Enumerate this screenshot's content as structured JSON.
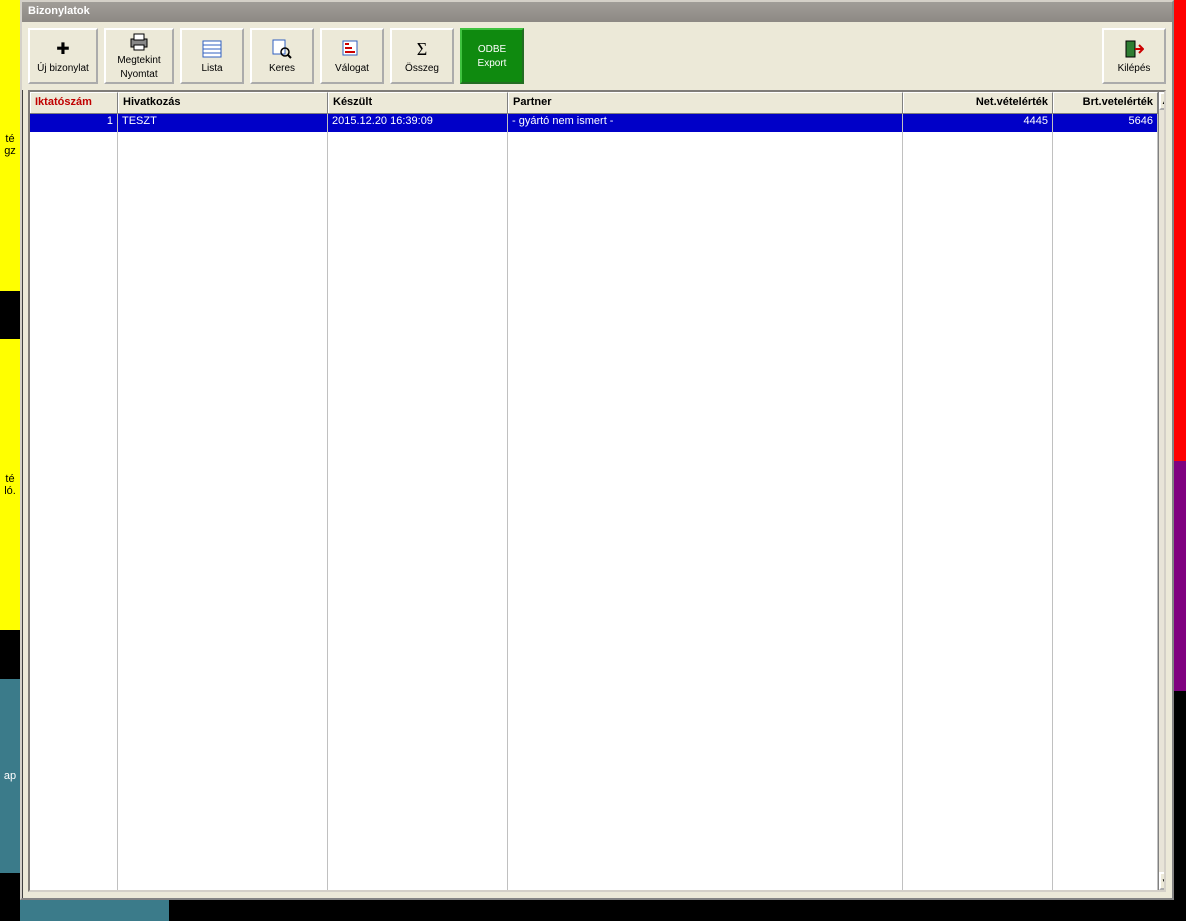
{
  "window": {
    "title": "Bizonylatok"
  },
  "toolbar": {
    "new_label1": "✚",
    "new_label": "Új bizonylat",
    "view_label1": "Megtekint",
    "view_label2": "Nyomtat",
    "list_label": "Lista",
    "search_label": "Keres",
    "sort_label": "Válogat",
    "sum_label": "Összeg",
    "export_label1": "ODBE",
    "export_label2": "Export",
    "exit_label": "Kilépés"
  },
  "grid": {
    "headers": {
      "c1": "Iktatószám",
      "c2": "Hivatkozás",
      "c3": "Készült",
      "c4": "Partner",
      "c5": "Net.vételérték",
      "c6": "Brt.vetelérték"
    },
    "rows": [
      {
        "c1": "1",
        "c2": "TESZT",
        "c3": "2015.12.20 16:39:09",
        "c4": "- gyártó nem ismert -",
        "c5": "4445",
        "c6": "5646"
      }
    ]
  },
  "bg_left": {
    "t1": "té",
    "t2": "gz",
    "t3": "té",
    "t4": "ló.",
    "t5": "ap"
  }
}
